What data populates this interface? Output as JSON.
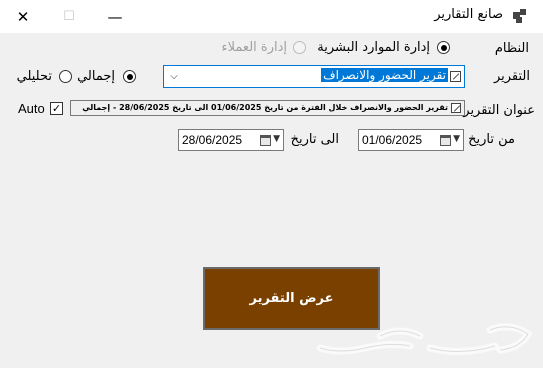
{
  "window": {
    "title": "صانع التقارير",
    "close_glyph": "✕",
    "maximize_glyph": "☐",
    "minimize_glyph": "—"
  },
  "system": {
    "label": "النظام",
    "options": [
      {
        "label": "إدارة الموارد البشرية",
        "checked": true,
        "enabled": true
      },
      {
        "label": "إدارة العملاء",
        "checked": false,
        "enabled": false
      }
    ]
  },
  "report": {
    "label": "التقرير",
    "selected": "تقرير الحضور والانصراف",
    "mode_options": [
      {
        "label": "إجمالي",
        "checked": true
      },
      {
        "label": "تحليلي",
        "checked": false
      }
    ]
  },
  "report_title": {
    "label": "عنوان التقرير",
    "value": "تقرير الحضور والانصراف خلال الفترة من تاريخ 01/06/2025 الى تاريخ 28/06/2025 - إجمالي",
    "auto_label": "Auto",
    "auto_checked": true,
    "check_glyph": "✓"
  },
  "dates": {
    "from_label": "من تاريخ",
    "from_value": "01/06/2025",
    "to_label": "الى تاريخ",
    "to_value": "28/06/2025"
  },
  "actions": {
    "show_report": "عرض التقرير"
  },
  "colors": {
    "accent": "#0078d7",
    "button_bg": "#7a4000"
  }
}
